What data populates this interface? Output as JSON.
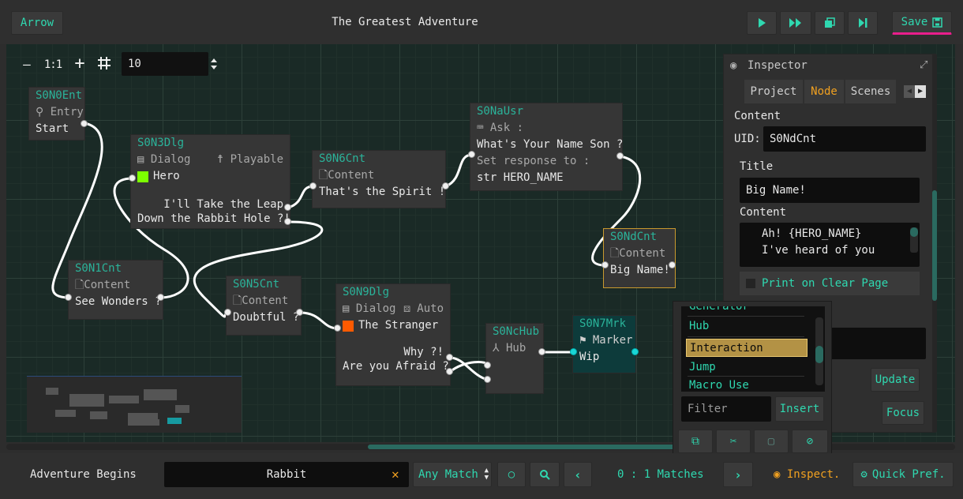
{
  "topbar": {
    "arrow_label": "Arrow",
    "title": "The Greatest Adventure",
    "save_label": "Save"
  },
  "toolbar": {
    "zoom_out": "—",
    "zoom_reset": "1:1",
    "zoom_in": "+",
    "grid_value": "10"
  },
  "nodes": {
    "entry": {
      "id": "S0N0Ent",
      "type": "Entry",
      "slot": "Start"
    },
    "dlg3": {
      "id": "S0N3Dlg",
      "type": "Dialog",
      "flag": "Playable",
      "character": "Hero",
      "line1": "I'll Take the Leap",
      "line2": "Down the Rabbit Hole ?!"
    },
    "cnt6": {
      "id": "S0N6Cnt",
      "type": "Content",
      "text": "That's the Spirit !"
    },
    "usr": {
      "id": "S0NaUsr",
      "type": "Ask :",
      "question": "What's Your Name Son ?",
      "set": "Set response to :",
      "var_type": "str",
      "var": "HERO_NAME"
    },
    "cntd": {
      "id": "S0NdCnt",
      "type": "Content",
      "text": "Big Name!"
    },
    "cnt1": {
      "id": "S0N1Cnt",
      "type": "Content",
      "text": "See Wonders ?"
    },
    "cnt5": {
      "id": "S0N5Cnt",
      "type": "Content",
      "text": "Doubtful ?"
    },
    "dlg9": {
      "id": "S0N9Dlg",
      "type": "Dialog",
      "flag": "Auto",
      "character": "The Stranger",
      "line1": "Why ?!",
      "line2": "Are you Afraid ?"
    },
    "hub": {
      "id": "S0NcHub",
      "type": "Hub"
    },
    "mrk": {
      "id": "S0N7Mrk",
      "type": "Marker",
      "text": "Wip"
    }
  },
  "inspector": {
    "title": "Inspector",
    "tabs": [
      "Project",
      "Node",
      "Scenes"
    ],
    "active_tab": "Node",
    "section": "Content",
    "uid_label": "UID:",
    "uid_value": "S0NdCnt",
    "title_label": "Title",
    "title_value": "Big Name!",
    "content_label": "Content",
    "content_line1": "Ah! {HERO_NAME}",
    "content_line2": "I've heard of you",
    "print_label": "Print on Clear Page",
    "update_label": "Update",
    "focus_label": "Focus"
  },
  "popup": {
    "partial_item": "Generator",
    "items": [
      "Hub",
      "Interaction",
      "Jump",
      "Macro Use"
    ],
    "selected": "Interaction",
    "filter_placeholder": "Filter",
    "insert_label": "Insert"
  },
  "bottombar": {
    "scene_name": "Adventure Begins",
    "query": "Rabbit",
    "match_mode": "Any Match",
    "matches": "0 : 1 Matches",
    "inspect_label": "Inspect.",
    "quickpref_label": "Quick Pref."
  },
  "colors": {
    "accent": "#2fd8b0",
    "node_title": "#2ab39a",
    "hero": "#7cff00",
    "stranger": "#ff5a00",
    "selected_border": "#c99a2e",
    "marker_bg": "#0d3b3b",
    "save_underline": "#e91e8c"
  }
}
